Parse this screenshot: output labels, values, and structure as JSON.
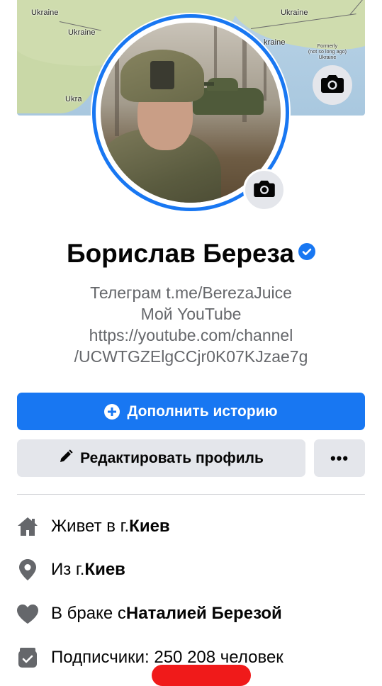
{
  "cover": {
    "map_labels": {
      "l1": "Ukraine",
      "l2": "Ukraine",
      "l3": "Ukraine",
      "l4": "kraine",
      "l5": "Formerly",
      "l6": "(not so long ago)",
      "l7": "Ukraine",
      "l8": "Ukra"
    },
    "camera_icon": "camera-icon"
  },
  "avatar": {
    "camera_icon": "camera-icon",
    "ring_color": "#1877f2"
  },
  "profile": {
    "name": "Борислав Береза",
    "verified_icon": "verified-badge-icon",
    "bio": {
      "line1": "Телеграм t.me/BerezaJuice",
      "line2": "Мой YouTube",
      "line3": "https://youtube.com/channel",
      "line4": "/UCWTGZElgCCjr0K07KJzae7g"
    }
  },
  "actions": {
    "add_story_label": "Дополнить историю",
    "add_story_icon": "plus-circle-icon",
    "edit_profile_label": "Редактировать профиль",
    "edit_profile_icon": "pencil-icon",
    "more_label": "•••"
  },
  "details": {
    "lives": {
      "prefix": "Живет в г. ",
      "value": "Киев",
      "icon": "home-icon"
    },
    "from": {
      "prefix": "Из г. ",
      "value": "Киев",
      "icon": "location-pin-icon"
    },
    "relationship": {
      "prefix": "В браке с ",
      "value": "Наталией Березой",
      "icon": "heart-icon"
    },
    "followers": {
      "text": "Подписчики: 250 208 человек",
      "icon": "followers-icon"
    }
  },
  "colors": {
    "accent": "#1877f2",
    "button_secondary": "#e4e6eb",
    "secondary_text": "#65676b",
    "annotation": "#f01a1a"
  }
}
